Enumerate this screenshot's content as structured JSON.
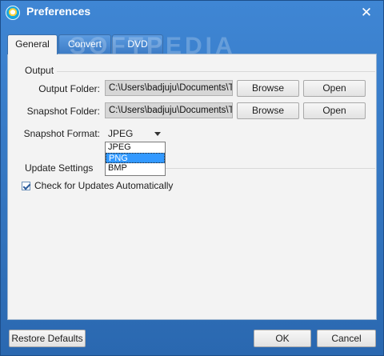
{
  "window": {
    "title": "Preferences",
    "close_icon": "close-icon"
  },
  "tabs": [
    {
      "label": "General",
      "active": true
    },
    {
      "label": "Convert",
      "active": false
    },
    {
      "label": "DVD",
      "active": false
    }
  ],
  "watermark": "SOFTPEDIA",
  "output": {
    "heading": "Output",
    "output_folder_label": "Output Folder:",
    "output_folder_value": "C:\\Users\\badjuju\\Documents\\Tipard Studio",
    "snapshot_folder_label": "Snapshot Folder:",
    "snapshot_folder_value": "C:\\Users\\badjuju\\Documents\\Tipard Studio",
    "browse_label": "Browse",
    "open_label": "Open",
    "snapshot_format_label": "Snapshot Format:",
    "snapshot_format_value": "JPEG",
    "format_options": [
      "JPEG",
      "PNG",
      "BMP"
    ],
    "highlighted_option": "PNG"
  },
  "update": {
    "heading": "Update Settings",
    "check_label": "Check for Updates Automatically",
    "checked": true
  },
  "footer": {
    "restore_label": "Restore Defaults",
    "ok_label": "OK",
    "cancel_label": "Cancel"
  },
  "colors": {
    "titlebar": "#2f6fb5",
    "panel": "#f3f3f3",
    "highlight": "#3399ff"
  }
}
